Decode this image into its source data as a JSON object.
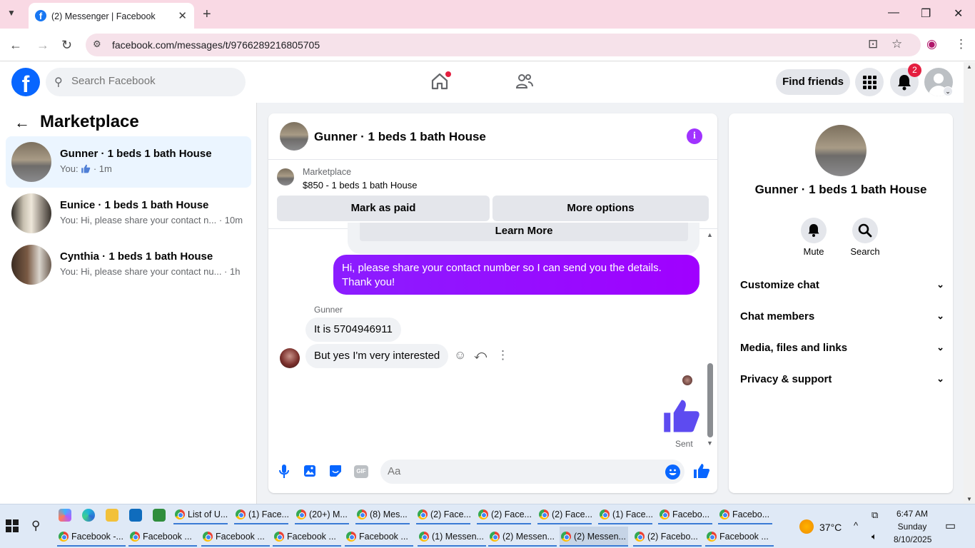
{
  "browser": {
    "tab_title": "(2) Messenger | Facebook",
    "new_tab": "+",
    "url": "facebook.com/messages/t/9766289216805705"
  },
  "fb": {
    "search_placeholder": "Search Facebook",
    "find_friends": "Find friends",
    "notif_count": "2"
  },
  "left": {
    "title": "Marketplace",
    "conversations": [
      {
        "name": "Gunner · 1 beds 1 bath House",
        "snippet_you": "You:",
        "snippet_time": "· 1m"
      },
      {
        "name": "Eunice · 1 beds 1 bath House",
        "snippet": "You: Hi, please share your contact n... · 10m"
      },
      {
        "name": "Cynthia · 1 beds 1 bath House",
        "snippet": "You: Hi, please share your contact nu... · 1h"
      }
    ]
  },
  "chat": {
    "title": "Gunner · 1 beds 1 bath House",
    "marketplace_label": "Marketplace",
    "listing": "$850 - 1 beds 1 bath House",
    "mark_paid": "Mark as paid",
    "more_options": "More options",
    "learn_more": "Learn More",
    "outgoing": "Hi, please share your contact number so I can send you the details. Thank you!",
    "sender": "Gunner",
    "incoming": [
      "It is 5704946911",
      "But yes I'm very interested"
    ],
    "sent_label": "Sent",
    "composer_placeholder": "Aa"
  },
  "right": {
    "title": "Gunner · 1 beds 1 bath House",
    "mute": "Mute",
    "search": "Search",
    "sections": [
      "Customize chat",
      "Chat members",
      "Media, files and links",
      "Privacy & support"
    ]
  },
  "taskbar": {
    "row1": [
      "List of U...",
      "(1) Face...",
      "(20+) M...",
      "(8) Mes...",
      "(2) Face...",
      "(2) Face...",
      "(2) Face...",
      "(1) Face...",
      "Facebo...",
      "Facebo..."
    ],
    "row2": [
      "Facebook -...",
      "Facebook ...",
      "Facebook ...",
      "Facebook ...",
      "Facebook ...",
      "(1) Messen...",
      "(2) Messen...",
      "(2) Messen...",
      "(2) Facebo...",
      "Facebook ..."
    ],
    "temperature": "37°C",
    "time": "6:47 AM",
    "day": "Sunday",
    "date": "8/10/2025"
  },
  "colors": {
    "fb_blue": "#0866ff",
    "messenger_purple": "#a033ff",
    "badge_red": "#e41e3f"
  }
}
